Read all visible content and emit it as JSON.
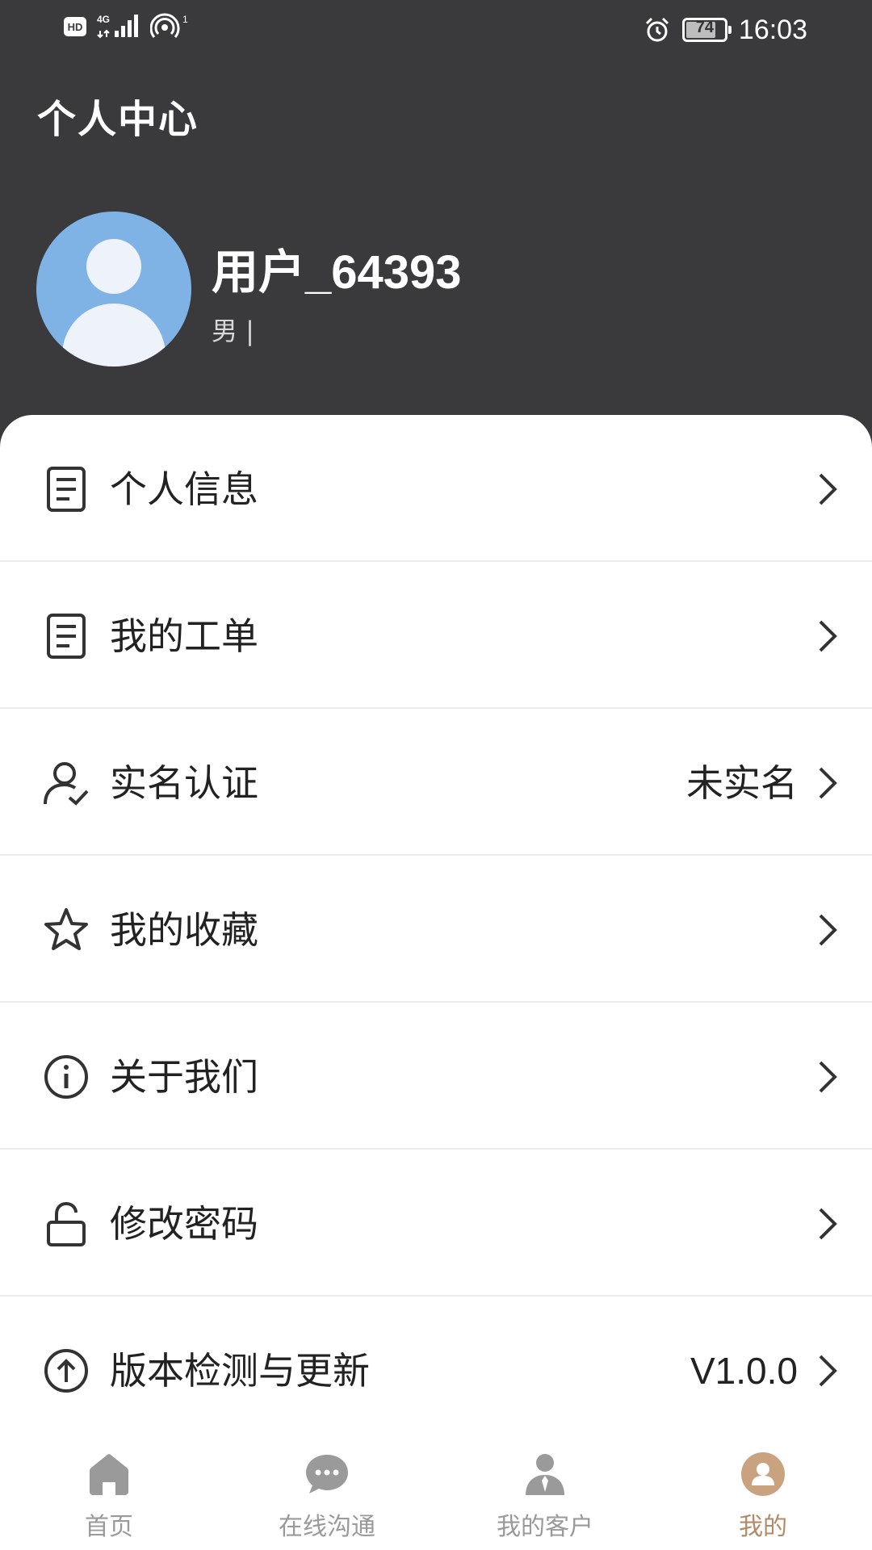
{
  "status_bar": {
    "network_hd": "HD",
    "network_type": "4G",
    "hotspot_count": "1",
    "battery_level": "74",
    "time": "16:03"
  },
  "header": {
    "title": "个人中心",
    "username": "用户_64393",
    "gender_line": "男 |"
  },
  "menu": [
    {
      "label": "个人信息",
      "value": "",
      "icon": "document-icon"
    },
    {
      "label": "我的工单",
      "value": "",
      "icon": "document-icon"
    },
    {
      "label": "实名认证",
      "value": "未实名",
      "icon": "user-verify-icon"
    },
    {
      "label": "我的收藏",
      "value": "",
      "icon": "star-icon"
    },
    {
      "label": "关于我们",
      "value": "",
      "icon": "info-icon"
    },
    {
      "label": "修改密码",
      "value": "",
      "icon": "lock-icon"
    },
    {
      "label": "版本检测与更新",
      "value": "V1.0.0",
      "icon": "upload-arrow-icon"
    }
  ],
  "bottom_nav": [
    {
      "label": "首页",
      "icon": "home-icon",
      "active": false
    },
    {
      "label": "在线沟通",
      "icon": "chat-icon",
      "active": false
    },
    {
      "label": "我的客户",
      "icon": "customer-icon",
      "active": false
    },
    {
      "label": "我的",
      "icon": "profile-icon",
      "active": true
    }
  ],
  "colors": {
    "header_bg": "#3a3a3c",
    "avatar_bg": "#7fb3e6",
    "active_tab": "#b48a66",
    "inactive_tab": "#9a9a9a"
  }
}
